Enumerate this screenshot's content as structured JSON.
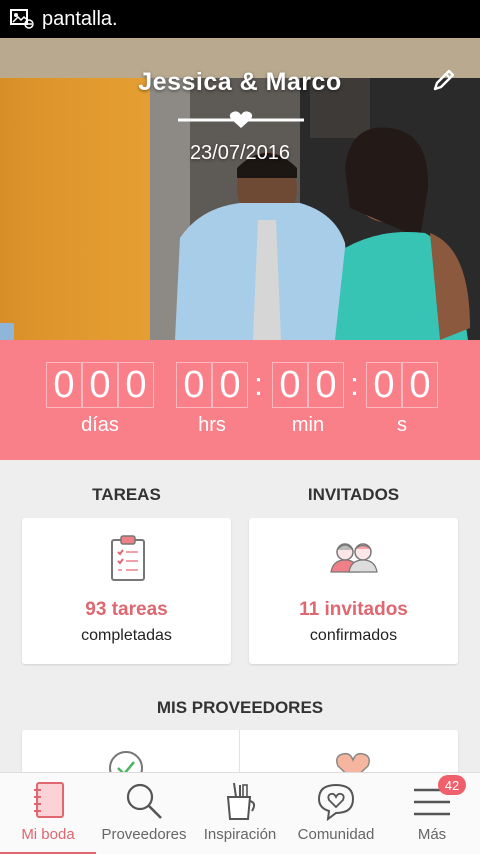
{
  "status_bar": {
    "text": "pantalla."
  },
  "hero": {
    "couple": "Jessica & Marco",
    "date": "23/07/2016"
  },
  "countdown": {
    "days": [
      "0",
      "0",
      "0"
    ],
    "hours": [
      "0",
      "0"
    ],
    "minutes": [
      "0",
      "0"
    ],
    "seconds": [
      "0",
      "0"
    ],
    "colon": ":",
    "labels": {
      "days": "días",
      "hours": "hrs",
      "minutes": "min",
      "seconds": "s"
    }
  },
  "tasks": {
    "title": "TAREAS",
    "count": "93 tareas",
    "caption": "completadas"
  },
  "guests": {
    "title": "INVITADOS",
    "count": "11 invitados",
    "caption": "confirmados"
  },
  "vendors": {
    "title": "MIS PROVEEDORES"
  },
  "nav": {
    "items": [
      {
        "label": "Mi boda",
        "icon": "notebook-icon"
      },
      {
        "label": "Proveedores",
        "icon": "search-icon"
      },
      {
        "label": "Inspiración",
        "icon": "inspiration-cup-icon"
      },
      {
        "label": "Comunidad",
        "icon": "chat-heart-icon"
      },
      {
        "label": "Más",
        "icon": "menu-icon"
      }
    ],
    "badge": "42"
  },
  "colors": {
    "accent": "#f97f89",
    "accent_text": "#e06670"
  }
}
